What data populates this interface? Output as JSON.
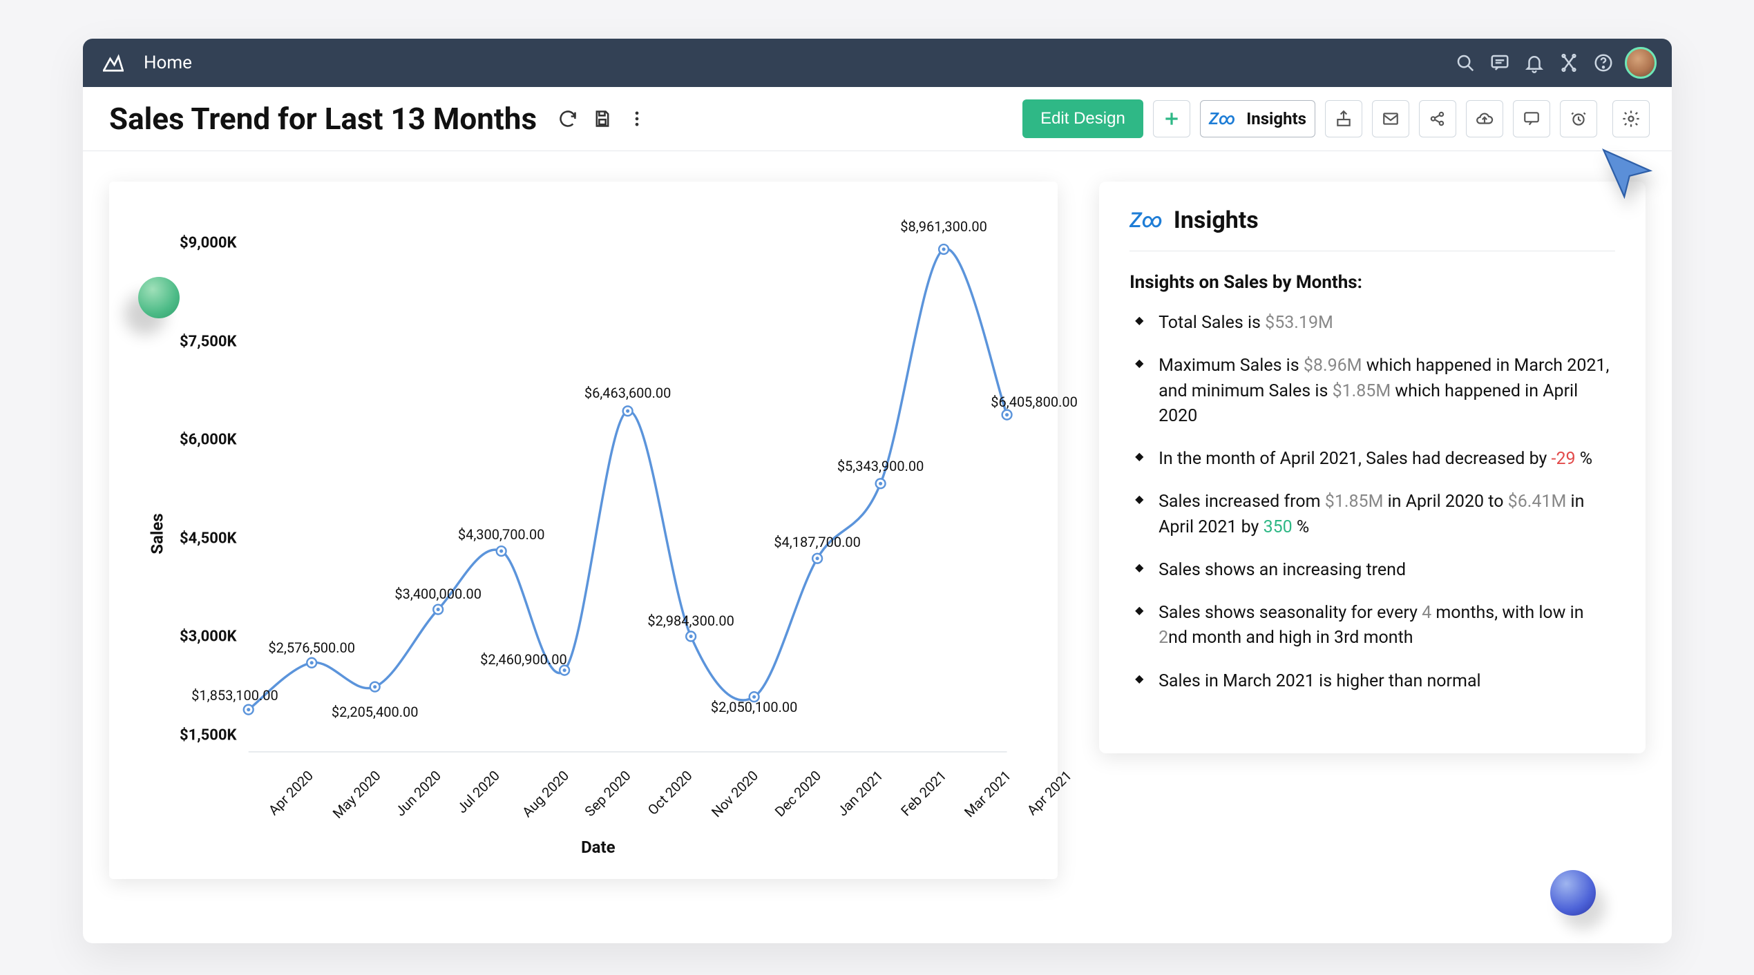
{
  "nav": {
    "home": "Home"
  },
  "header": {
    "title": "Sales Trend for Last 13 Months",
    "edit_design": "Edit Design",
    "insights_btn": "Insights"
  },
  "chart_data": {
    "type": "line",
    "title": "Sales Trend for Last 13 Months",
    "xlabel": "Date",
    "ylabel": "Sales",
    "categories": [
      "Apr 2020",
      "May 2020",
      "Jun 2020",
      "Jul 2020",
      "Aug 2020",
      "Sep 2020",
      "Oct 2020",
      "Nov 2020",
      "Dec 2020",
      "Jan 2021",
      "Feb 2021",
      "Mar 2021",
      "Apr 2021"
    ],
    "values": [
      1853100,
      2576500,
      2205400,
      3400000,
      4300700,
      2460900,
      6463600,
      2984300,
      2050100,
      4187700,
      5343900,
      8961300,
      6405800
    ],
    "data_labels": [
      "$1,853,100.00",
      "$2,576,500.00",
      "$2,205,400.00",
      "$3,400,000.00",
      "$4,300,700.00",
      "$2,460,900.00",
      "$6,463,600.00",
      "$2,984,300.00",
      "$2,050,100.00",
      "$4,187,700.00",
      "$5,343,900.00",
      "$8,961,300.00",
      "$6,405,800.00"
    ],
    "yticks": [
      1500000,
      3000000,
      4500000,
      6000000,
      7500000,
      9000000
    ],
    "ytick_labels": [
      "$1,500K",
      "$3,000K",
      "$4,500K",
      "$6,000K",
      "$7,500K",
      "$9,000K"
    ],
    "ylim": [
      1200000,
      9200000
    ]
  },
  "insights": {
    "heading": "Insights",
    "subheading": "Insights on Sales by Months:",
    "items": [
      {
        "parts": [
          {
            "t": "Total Sales is  "
          },
          {
            "t": "$53.19M",
            "c": "gray"
          }
        ]
      },
      {
        "parts": [
          {
            "t": "Maximum Sales is  "
          },
          {
            "t": "$8.96M",
            "c": "gray"
          },
          {
            "t": " which happened in March 2021, and minimum Sales is  "
          },
          {
            "t": "$1.85M",
            "c": "gray"
          },
          {
            "t": " which happened  in April 2020"
          }
        ]
      },
      {
        "parts": [
          {
            "t": " In the month of April 2021, Sales had decreased by "
          },
          {
            "t": "-29",
            "c": "red"
          },
          {
            "t": " %"
          }
        ]
      },
      {
        "parts": [
          {
            "t": "Sales increased from   "
          },
          {
            "t": "$1.85M",
            "c": "gray"
          },
          {
            "t": "  in April 2020 to  "
          },
          {
            "t": "$6.41M",
            "c": "gray"
          },
          {
            "t": " in April 2021 by "
          },
          {
            "t": "350",
            "c": "green"
          },
          {
            "t": " %"
          }
        ]
      },
      {
        "parts": [
          {
            "t": "Sales shows an increasing trend"
          }
        ]
      },
      {
        "parts": [
          {
            "t": "Sales shows seasonality for every "
          },
          {
            "t": "4",
            "c": "gray"
          },
          {
            "t": " months, with low in "
          },
          {
            "t": "2",
            "c": "gray"
          },
          {
            "t": "nd month and high in 3rd month"
          }
        ]
      },
      {
        "parts": [
          {
            "t": "Sales in March 2021 is higher than normal"
          }
        ]
      }
    ]
  }
}
